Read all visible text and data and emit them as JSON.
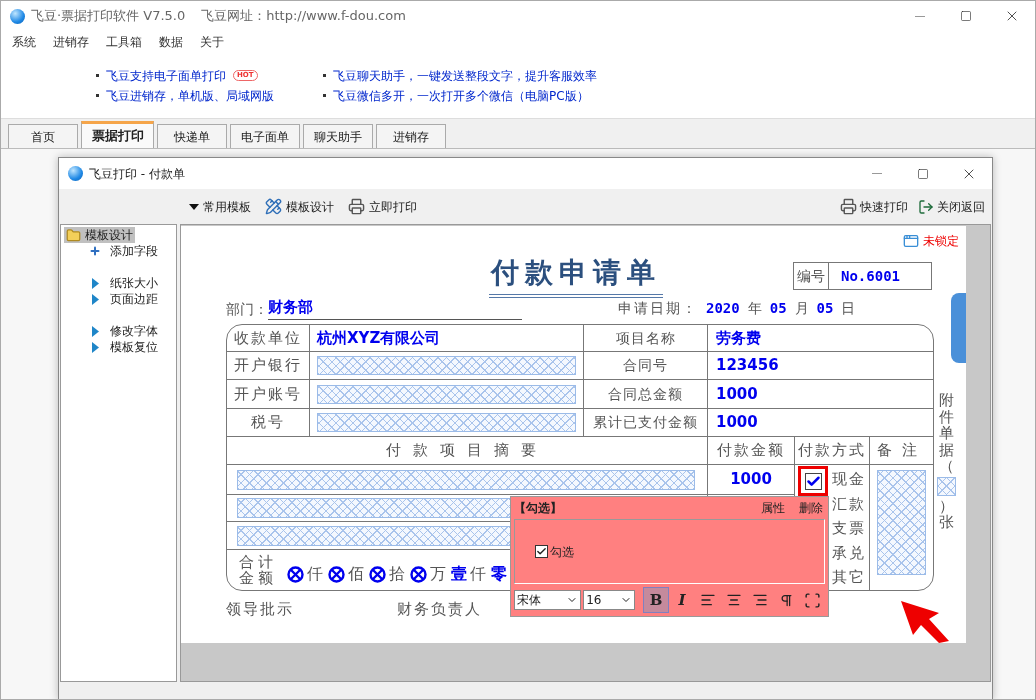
{
  "app": {
    "title": "飞豆·票据打印软件 V7.5.0",
    "website": "飞豆网址：http://www.f-dou.com"
  },
  "menu": [
    "系统",
    "进销存",
    "工具箱",
    "数据",
    "关于"
  ],
  "news": [
    {
      "text": "飞豆支持电子面单打印",
      "badge": "HOT"
    },
    {
      "text": "飞豆进销存，单机版、局域网版"
    },
    {
      "text": "飞豆聊天助手，一键发送整段文字，提升客服效率"
    },
    {
      "text": "飞豆微信多开，一次打开多个微信（电脑PC版）"
    }
  ],
  "tabs": [
    {
      "label": "首页",
      "selected": false
    },
    {
      "label": "票据打印",
      "selected": true
    },
    {
      "label": "快递单",
      "selected": false
    },
    {
      "label": "电子面单",
      "selected": false
    },
    {
      "label": "聊天助手",
      "selected": false
    },
    {
      "label": "进销存",
      "selected": false
    }
  ],
  "dialog": {
    "title": "飞豆打印 - 付款单",
    "toolbar_left": [
      {
        "label": "常用模板",
        "kind": "dropdown"
      },
      {
        "label": "模板设计",
        "kind": "design"
      },
      {
        "label": "立即打印",
        "kind": "print"
      }
    ],
    "toolbar_right": [
      {
        "label": "快速打印",
        "kind": "print"
      },
      {
        "label": "关闭返回",
        "kind": "exit"
      }
    ],
    "sidebar": {
      "label": "模板设计",
      "selected": true,
      "groups": [
        [
          {
            "label": "添加字段",
            "kind": "add"
          }
        ],
        [
          {
            "label": "纸张大小",
            "kind": "arrow"
          },
          {
            "label": "页面边距",
            "kind": "arrow"
          }
        ],
        [
          {
            "label": "修改字体",
            "kind": "arrow"
          },
          {
            "label": "模板复位",
            "kind": "arrow"
          }
        ]
      ]
    },
    "lock_status": "未锁定",
    "form": {
      "title": "付款申请单",
      "number_label": "编号",
      "number": "No.6001",
      "dept_label": "部门：",
      "dept": "财务部",
      "date_label": "申请日期：",
      "date_parts": [
        {
          "kind": "value",
          "text": "2020"
        },
        {
          "kind": "unit",
          "text": "年"
        },
        {
          "kind": "value",
          "text": "05"
        },
        {
          "kind": "unit",
          "text": "月"
        },
        {
          "kind": "value",
          "text": "05"
        },
        {
          "kind": "unit",
          "text": "日"
        }
      ],
      "rows": [
        {
          "label": "收款单位",
          "value": "杭州XYZ有限公司",
          "label2": "项目名称",
          "value2": "劳务费"
        },
        {
          "label": "开户银行",
          "label2": "合同号",
          "value2": "123456"
        },
        {
          "label": "开户账号",
          "label2": "合同总金额",
          "value2": "1000"
        },
        {
          "label": "税号",
          "label2": "累计已支付金额",
          "value2": "1000"
        }
      ],
      "headers": [
        "付款项目摘要",
        "付款金额",
        "付款方式",
        "备注"
      ],
      "items": [
        {
          "kind": "field",
          "amount": "1000"
        },
        {
          "kind": "field"
        },
        {
          "kind": "field"
        }
      ],
      "cash_checkbox": {
        "checked": true
      },
      "methods": [
        "现金",
        "汇款",
        "支票",
        "承兑",
        "其它"
      ],
      "total_label": [
        "合计",
        "金额"
      ],
      "total_digits": [
        {
          "kind": "blank",
          "unit": "仟"
        },
        {
          "kind": "blank",
          "unit": "佰"
        },
        {
          "kind": "blank",
          "unit": "拾"
        },
        {
          "kind": "blank",
          "unit": "万"
        },
        {
          "kind": "digit",
          "value": "壹",
          "unit": "仟"
        },
        {
          "kind": "digit",
          "value": "零"
        }
      ],
      "attachment": [
        "附件单据（",
        "）张"
      ],
      "signatures": [
        "领导批示",
        "财务负责人"
      ]
    },
    "popup": {
      "title": "【勾选】",
      "actions": [
        "属性",
        "删除"
      ],
      "checkbox": {
        "label": "勾选",
        "checked": true
      },
      "font": "宋体",
      "size": "16",
      "format_buttons": [
        {
          "kind": "bold",
          "label": "B",
          "selected": true
        },
        {
          "kind": "italic",
          "label": "I",
          "selected": false
        },
        {
          "kind": "align-left",
          "selected": false
        },
        {
          "kind": "align-center",
          "selected": false
        },
        {
          "kind": "align-right",
          "selected": false
        },
        {
          "kind": "paragraph",
          "selected": false
        },
        {
          "kind": "frame",
          "selected": false
        }
      ]
    }
  }
}
